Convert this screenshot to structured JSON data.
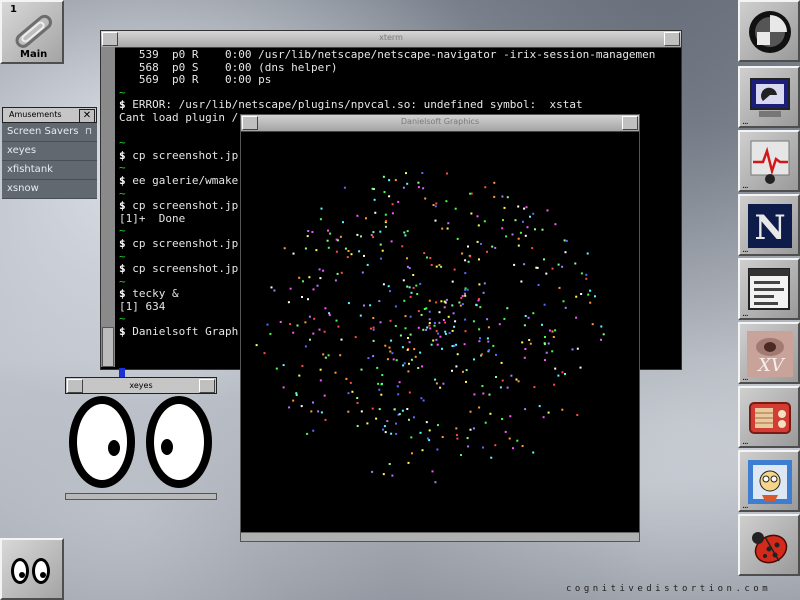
{
  "workspace": {
    "number": "1",
    "name": "Main"
  },
  "menu": {
    "title": "Amusements",
    "close": "✕",
    "items": [
      {
        "label": "Screen Savers",
        "submenu": "⊓"
      },
      {
        "label": "xeyes"
      },
      {
        "label": "xfishtank"
      },
      {
        "label": "xsnow"
      }
    ]
  },
  "xterm": {
    "title": "xterm",
    "lines": [
      {
        "text": "   539  p0 R    0:00 /usr/lib/netscape/netscape-navigator -irix-session-managemen"
      },
      {
        "text": "   568  p0 S    0:00 (dns helper)"
      },
      {
        "text": "   569  p0 R    0:00 ps"
      },
      {
        "tilde": "~"
      },
      {
        "prompt": "$ ",
        "text": "ERROR: /usr/lib/netscape/plugins/npvcal.so: undefined symbol:  xstat"
      },
      {
        "text": "Cant load plugin /"
      },
      {
        "text": ""
      },
      {
        "tilde": "~"
      },
      {
        "prompt": "$ ",
        "text": "cp screenshot.jp"
      },
      {
        "tilde": "~"
      },
      {
        "prompt": "$ ",
        "text": "ee galerie/wmake"
      },
      {
        "tilde": "~"
      },
      {
        "prompt": "$ ",
        "text": "cp screenshot.jp"
      },
      {
        "text": "[1]+  Done"
      },
      {
        "tilde": "~"
      },
      {
        "prompt": "$ ",
        "text": "cp screenshot.jp"
      },
      {
        "tilde": "~"
      },
      {
        "prompt": "$ ",
        "text": "cp screenshot.jp"
      },
      {
        "tilde": "~"
      },
      {
        "prompt": "$ ",
        "text": "tecky &"
      },
      {
        "text": "[1] 634"
      },
      {
        "tilde": "~"
      },
      {
        "prompt": "$ ",
        "text": "Danielsoft Graph"
      }
    ]
  },
  "graphics": {
    "title": "Danielsoft Graphics"
  },
  "xeyes": {
    "title": "xeyes"
  },
  "dock": [
    {
      "icon": "wmaker-logo-icon"
    },
    {
      "icon": "monitor-icon"
    },
    {
      "icon": "heart-monitor-icon"
    },
    {
      "icon": "netscape-icon",
      "label": "N"
    },
    {
      "icon": "terminal-window-icon"
    },
    {
      "icon": "xv-icon",
      "label": "XV"
    },
    {
      "icon": "radio-icon"
    },
    {
      "icon": "scientist-icon"
    },
    {
      "icon": "ladybug-icon"
    }
  ],
  "watermark": "cognitivedistortion.com",
  "colors": {
    "terminal_bg": "#000000",
    "tilde": "#2bd02b",
    "menu_bg": "#626870",
    "cursor": "#1b2fd6"
  }
}
